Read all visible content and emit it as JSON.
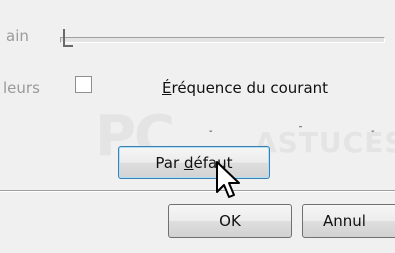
{
  "labels": {
    "gain": "ain",
    "couleurs": "leurs",
    "frequence_prefix": "É",
    "frequence_rest": "réquence du courant"
  },
  "ticks": [
    "-",
    "ˉ",
    "-"
  ],
  "watermark": {
    "main": "PC",
    "secondary": "ASTUCES"
  },
  "buttons": {
    "default_prefix": "Par ",
    "default_u": "d",
    "default_rest": "éfaut",
    "ok": "OK",
    "annuler": "Annul"
  },
  "icons": {
    "cursor": "arrow-cursor-icon"
  }
}
